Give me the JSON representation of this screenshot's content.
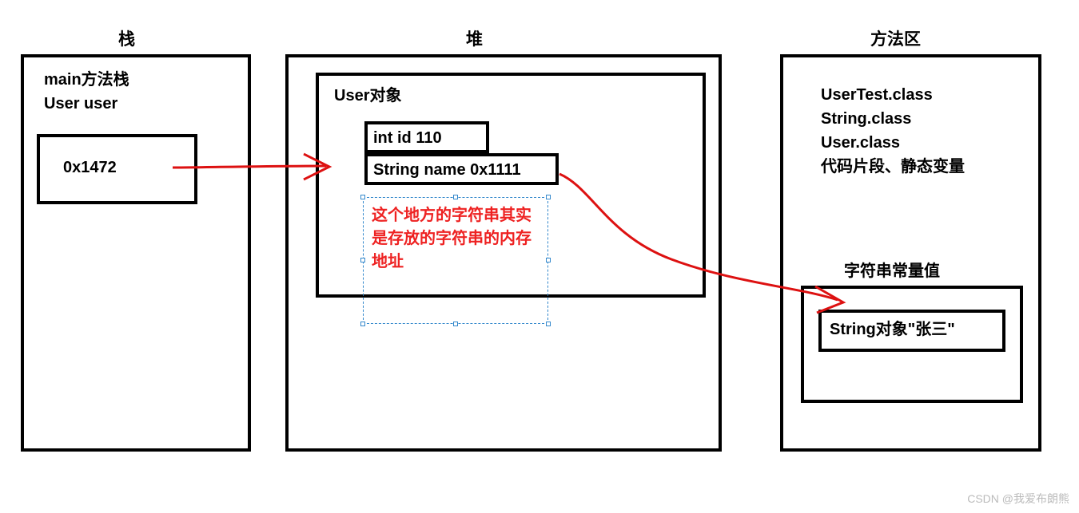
{
  "titles": {
    "stack": "栈",
    "heap": "堆",
    "method_area": "方法区"
  },
  "stack": {
    "label_main": "main方法栈",
    "label_user": "User user",
    "address": "0x1472"
  },
  "heap": {
    "object_title": "User对象",
    "int_field": "int id 110",
    "string_field": "String name 0x1111",
    "note_line1": "这个地方的字符串其实",
    "note_line2": "是存放的字符串的内存",
    "note_line3": "地址"
  },
  "method_area": {
    "class1": "UserTest.class",
    "class2": "String.class",
    "class3": "User.class",
    "misc": "代码片段、静态变量",
    "pool_title": "字符串常量值",
    "string_object": "String对象\"张三\""
  },
  "watermark": "CSDN @我爱布朗熊"
}
